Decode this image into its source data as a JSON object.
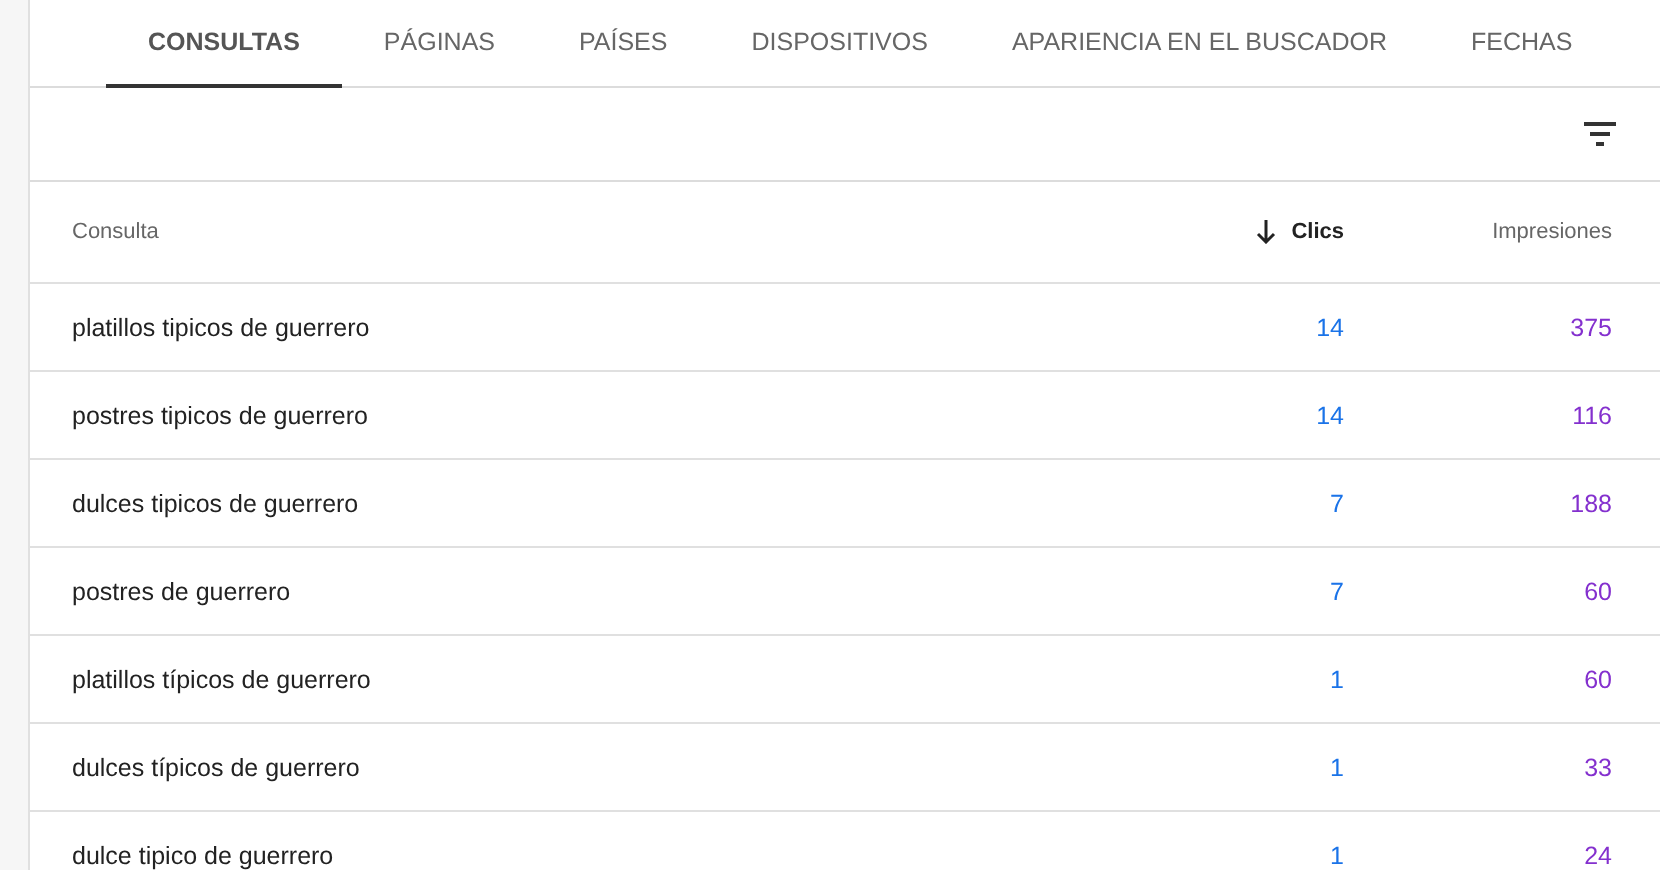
{
  "tabs": [
    {
      "label": "CONSULTAS",
      "selected": true
    },
    {
      "label": "PÁGINAS",
      "selected": false
    },
    {
      "label": "PAÍSES",
      "selected": false
    },
    {
      "label": "DISPOSITIVOS",
      "selected": false
    },
    {
      "label": "APARIENCIA EN EL BUSCADOR",
      "selected": false
    },
    {
      "label": "FECHAS",
      "selected": false
    }
  ],
  "table": {
    "columns": [
      {
        "label": "Consulta",
        "sorted": false
      },
      {
        "label": "Clics",
        "sorted": true
      },
      {
        "label": "Impresiones",
        "sorted": false
      }
    ],
    "rows": [
      [
        "platillos tipicos de guerrero",
        "14",
        "375"
      ],
      [
        "postres tipicos de guerrero",
        "14",
        "116"
      ],
      [
        "dulces tipicos de guerrero",
        "7",
        "188"
      ],
      [
        "postres de guerrero",
        "7",
        "60"
      ],
      [
        "platillos típicos de guerrero",
        "1",
        "60"
      ],
      [
        "dulces típicos de guerrero",
        "1",
        "33"
      ],
      [
        "dulce tipico de guerrero",
        "1",
        "24"
      ]
    ]
  }
}
